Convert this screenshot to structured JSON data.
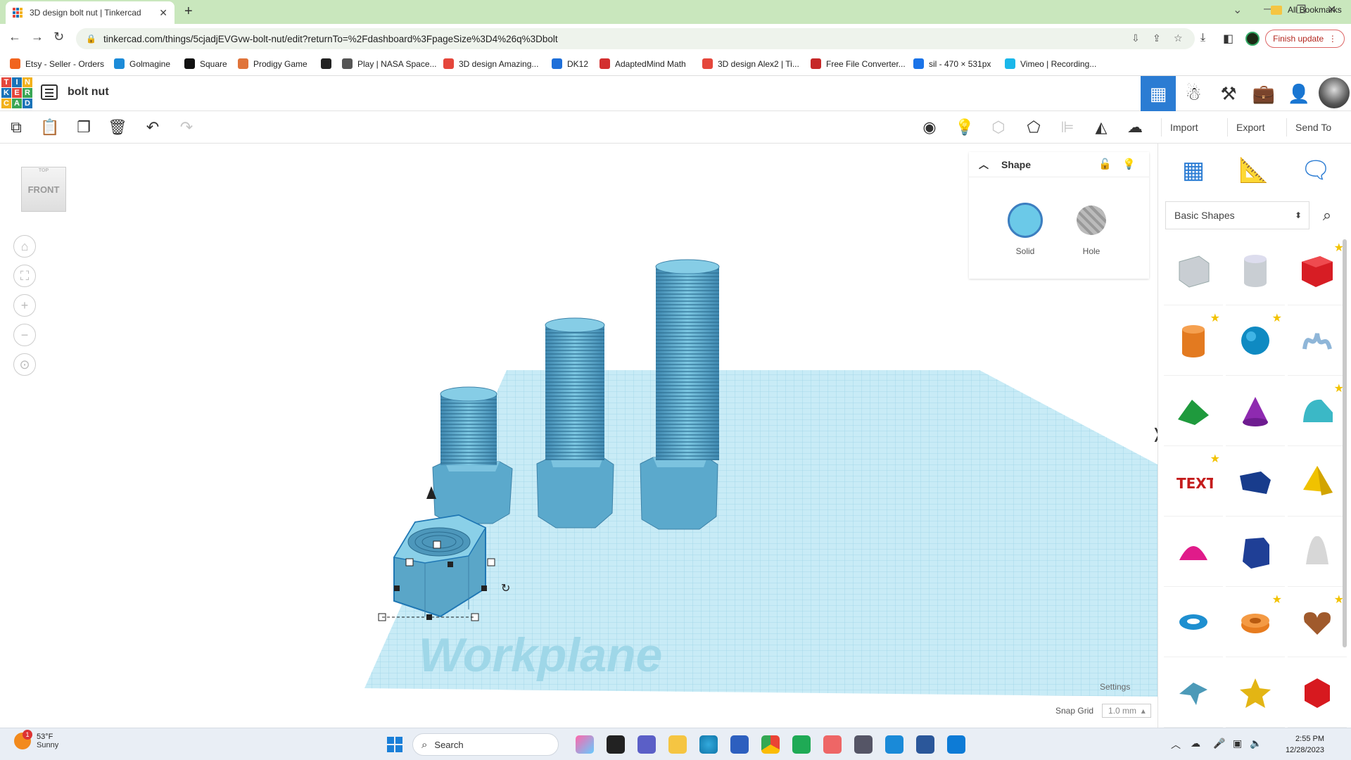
{
  "browser": {
    "tab_title": "3D design bolt nut | Tinkercad",
    "url": "tinkercad.com/things/5cjadjEVGvw-bolt-nut/edit?returnTo=%2Fdashboard%3FpageSize%3D4%26q%3Dbolt",
    "finish_update": "Finish update",
    "all_bookmarks": "All Bookmarks",
    "bookmarks": [
      {
        "label": "Etsy - Seller - Orders",
        "color": "#f1641e"
      },
      {
        "label": "Golmagine",
        "color": "#1c8bd8"
      },
      {
        "label": "Square",
        "color": "#111111"
      },
      {
        "label": "Prodigy Game",
        "color": "#e0743a"
      },
      {
        "label": "",
        "color": "#222222"
      },
      {
        "label": "Play | NASA Space...",
        "color": "#555555"
      },
      {
        "label": "3D design Amazing...",
        "color": "#e5463b"
      },
      {
        "label": "DK12",
        "color": "#1e6fd9"
      },
      {
        "label": "AdaptedMind Math",
        "color": "#d32f2f"
      },
      {
        "label": "3D design Alex2 | Ti...",
        "color": "#e5463b"
      },
      {
        "label": "Free File Converter...",
        "color": "#c62828"
      },
      {
        "label": "sil - 470 × 531px",
        "color": "#1a73e8"
      },
      {
        "label": "Vimeo | Recording...",
        "color": "#1ab7ea"
      }
    ]
  },
  "app": {
    "logo_letters": [
      "T",
      "I",
      "N",
      "K",
      "E",
      "R",
      "C",
      "A",
      "D"
    ],
    "design_title": "bolt nut",
    "toolbar": {
      "import": "Import",
      "export": "Export",
      "send_to": "Send To"
    },
    "viewcube_label": "FRONT",
    "shape_panel": {
      "title": "Shape",
      "solid_label": "Solid",
      "hole_label": "Hole",
      "solid_color": "#6bc9e8"
    },
    "workplane_label": "Workplane",
    "settings_label": "Settings",
    "snap_grid_label": "Snap Grid",
    "snap_grid_value": "1.0 mm",
    "library": {
      "category": "Basic Shapes",
      "items": [
        {
          "name": "box-hole-icon",
          "starred": false
        },
        {
          "name": "cylinder-hole-icon",
          "starred": false
        },
        {
          "name": "box-icon",
          "starred": true
        },
        {
          "name": "cylinder-icon",
          "starred": true
        },
        {
          "name": "sphere-icon",
          "starred": true
        },
        {
          "name": "scribble-icon",
          "starred": false
        },
        {
          "name": "roof-icon",
          "starred": false
        },
        {
          "name": "cone-icon",
          "starred": false
        },
        {
          "name": "round-roof-icon",
          "starred": true
        },
        {
          "name": "text-icon",
          "starred": true
        },
        {
          "name": "wedge-icon",
          "starred": false
        },
        {
          "name": "pyramid-icon",
          "starred": false
        },
        {
          "name": "half-sphere-icon",
          "starred": false
        },
        {
          "name": "polygon-icon",
          "starred": false
        },
        {
          "name": "paraboloid-icon",
          "starred": false
        },
        {
          "name": "torus-icon",
          "starred": false
        },
        {
          "name": "tube-icon",
          "starred": true
        },
        {
          "name": "heart-icon",
          "starred": true
        },
        {
          "name": "star-icon",
          "starred": false
        },
        {
          "name": "star-gold-icon",
          "starred": false
        },
        {
          "name": "icosahedron-icon",
          "starred": false
        }
      ]
    }
  },
  "taskbar": {
    "temperature": "53°F",
    "condition": "Sunny",
    "weather_badge": "1",
    "search_placeholder": "Search",
    "time": "2:55 PM",
    "date": "12/28/2023"
  }
}
